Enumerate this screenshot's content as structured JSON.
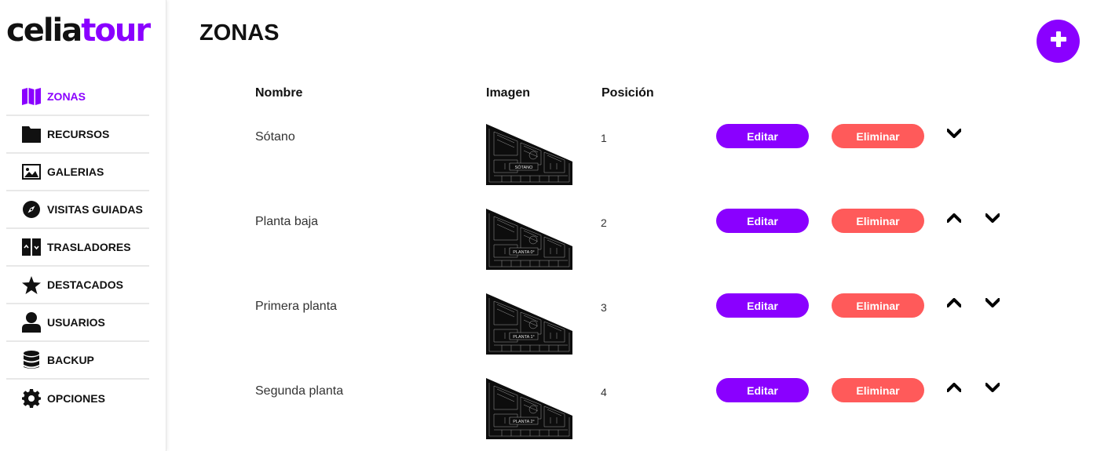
{
  "app": {
    "logo_part1": "celia",
    "logo_part2": "tour",
    "brand_color": "#8a00ff",
    "danger_color": "#ff5a5a"
  },
  "sidebar": {
    "items": [
      {
        "label": "ZONAS",
        "icon": "map-icon",
        "active": true
      },
      {
        "label": "RECURSOS",
        "icon": "folder-icon",
        "active": false
      },
      {
        "label": "GALERIAS",
        "icon": "image-icon",
        "active": false
      },
      {
        "label": "VISITAS GUIADAS",
        "icon": "compass-icon",
        "active": false
      },
      {
        "label": "TRASLADORES",
        "icon": "elevator-icon",
        "active": false
      },
      {
        "label": "DESTACADOS",
        "icon": "star-icon",
        "active": false
      },
      {
        "label": "USUARIOS",
        "icon": "user-icon",
        "active": false
      },
      {
        "label": "BACKUP",
        "icon": "database-icon",
        "active": false
      },
      {
        "label": "OPCIONES",
        "icon": "gear-icon",
        "active": false
      }
    ]
  },
  "main": {
    "title": "ZONAS",
    "add_icon": "plus-icon",
    "columns": {
      "name": "Nombre",
      "image": "Imagen",
      "position": "Posición"
    },
    "rows": [
      {
        "name": "Sótano",
        "image_label": "SÓTANO",
        "position": "1",
        "edit": "Editar",
        "delete": "Eliminar",
        "up": false,
        "down": true
      },
      {
        "name": "Planta baja",
        "image_label": "PLANTA 0°",
        "position": "2",
        "edit": "Editar",
        "delete": "Eliminar",
        "up": true,
        "down": true
      },
      {
        "name": "Primera planta",
        "image_label": "PLANTA 1°",
        "position": "3",
        "edit": "Editar",
        "delete": "Eliminar",
        "up": true,
        "down": true
      },
      {
        "name": "Segunda planta",
        "image_label": "PLANTA 2°",
        "position": "4",
        "edit": "Editar",
        "delete": "Eliminar",
        "up": true,
        "down": true
      }
    ]
  }
}
